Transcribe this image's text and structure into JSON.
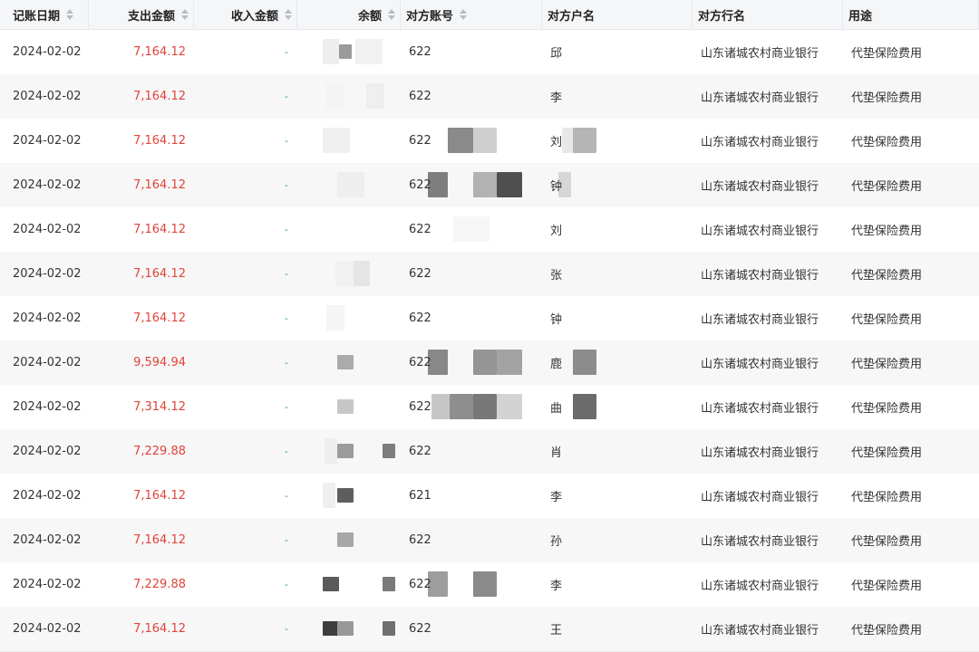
{
  "columns": [
    {
      "key": "date",
      "label": "记账日期",
      "sortable": true
    },
    {
      "key": "expense",
      "label": "支出金额",
      "sortable": true
    },
    {
      "key": "income",
      "label": "收入金额",
      "sortable": true
    },
    {
      "key": "balance",
      "label": "余额",
      "sortable": true
    },
    {
      "key": "account",
      "label": "对方账号",
      "sortable": true
    },
    {
      "key": "name",
      "label": "对方户名",
      "sortable": false
    },
    {
      "key": "bank",
      "label": "对方行名",
      "sortable": false
    },
    {
      "key": "purpose",
      "label": "用途",
      "sortable": false
    }
  ],
  "rows": [
    {
      "date": "2024-02-02",
      "expense": "7,164.12",
      "income": "-",
      "account": "622",
      "name": "邱",
      "bank": "山东诸城农村商业银行",
      "purpose": "代垫保险费用"
    },
    {
      "date": "2024-02-02",
      "expense": "7,164.12",
      "income": "-",
      "account": "622",
      "name": "李",
      "bank": "山东诸城农村商业银行",
      "purpose": "代垫保险费用"
    },
    {
      "date": "2024-02-02",
      "expense": "7,164.12",
      "income": "-",
      "account": "622",
      "name": "刘",
      "bank": "山东诸城农村商业银行",
      "purpose": "代垫保险费用"
    },
    {
      "date": "2024-02-02",
      "expense": "7,164.12",
      "income": "-",
      "account": "622",
      "name": "钟",
      "bank": "山东诸城农村商业银行",
      "purpose": "代垫保险费用"
    },
    {
      "date": "2024-02-02",
      "expense": "7,164.12",
      "income": "-",
      "account": "622",
      "name": "刘",
      "bank": "山东诸城农村商业银行",
      "purpose": "代垫保险费用"
    },
    {
      "date": "2024-02-02",
      "expense": "7,164.12",
      "income": "-",
      "account": "622",
      "name": "张",
      "bank": "山东诸城农村商业银行",
      "purpose": "代垫保险费用"
    },
    {
      "date": "2024-02-02",
      "expense": "7,164.12",
      "income": "-",
      "account": "622",
      "name": "钟",
      "bank": "山东诸城农村商业银行",
      "purpose": "代垫保险费用"
    },
    {
      "date": "2024-02-02",
      "expense": "9,594.94",
      "income": "-",
      "account": "622",
      "name": "鹿",
      "bank": "山东诸城农村商业银行",
      "purpose": "代垫保险费用"
    },
    {
      "date": "2024-02-02",
      "expense": "7,314.12",
      "income": "-",
      "account": "622",
      "name": "曲",
      "bank": "山东诸城农村商业银行",
      "purpose": "代垫保险费用"
    },
    {
      "date": "2024-02-02",
      "expense": "7,229.88",
      "income": "-",
      "account": "622",
      "name": "肖",
      "bank": "山东诸城农村商业银行",
      "purpose": "代垫保险费用"
    },
    {
      "date": "2024-02-02",
      "expense": "7,164.12",
      "income": "-",
      "account": "621",
      "name": "李",
      "bank": "山东诸城农村商业银行",
      "purpose": "代垫保险费用"
    },
    {
      "date": "2024-02-02",
      "expense": "7,164.12",
      "income": "-",
      "account": "622",
      "name": "孙",
      "bank": "山东诸城农村商业银行",
      "purpose": "代垫保险费用"
    },
    {
      "date": "2024-02-02",
      "expense": "7,229.88",
      "income": "-",
      "account": "622",
      "name": "李",
      "bank": "山东诸城农村商业银行",
      "purpose": "代垫保险费用"
    },
    {
      "date": "2024-02-02",
      "expense": "7,164.12",
      "income": "-",
      "account": "622",
      "name": "王",
      "bank": "山东诸城农村商业银行",
      "purpose": "代垫保险费用"
    }
  ],
  "colors": {
    "expense": "#e0433a",
    "income": "#2da44e",
    "header_bg": "#f5f6f8",
    "stripe": "#f7f7f7"
  }
}
